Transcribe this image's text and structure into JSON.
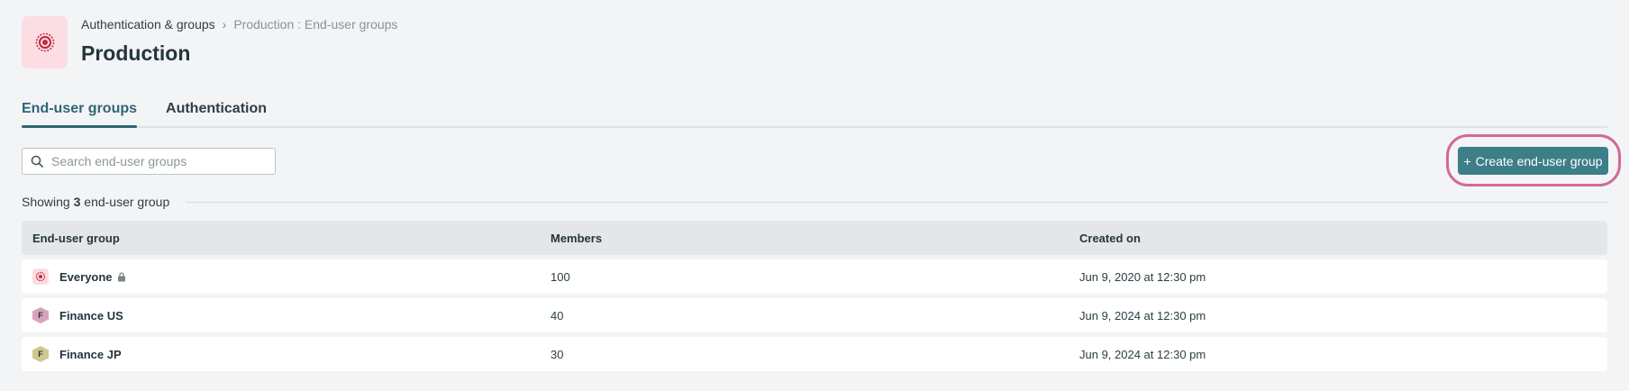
{
  "breadcrumb": {
    "parent": "Authentication & groups",
    "current": "Production : End-user groups"
  },
  "page": {
    "title": "Production"
  },
  "tabs": [
    {
      "label": "End-user groups",
      "active": true
    },
    {
      "label": "Authentication",
      "active": false
    }
  ],
  "search": {
    "placeholder": "Search end-user groups",
    "value": ""
  },
  "actions": {
    "create_label": "Create end-user group",
    "create_icon": "plus-icon"
  },
  "summary": {
    "prefix": "Showing",
    "count": "3",
    "suffix": "end-user group"
  },
  "table": {
    "columns": [
      "End-user group",
      "Members",
      "Created on"
    ],
    "rows": [
      {
        "name": "Everyone",
        "initial": "",
        "icon": "everyone-icon",
        "locked": true,
        "members": "100",
        "created": "Jun 9, 2020 at 12:30 pm"
      },
      {
        "name": "Finance US",
        "initial": "F",
        "icon": "hexagon-avatar",
        "avatar_color": "#d7a3bd",
        "locked": false,
        "members": "40",
        "created": "Jun 9, 2024 at 12:30 pm"
      },
      {
        "name": "Finance JP",
        "initial": "F",
        "icon": "hexagon-avatar",
        "avatar_color": "#cdc98f",
        "locked": false,
        "members": "30",
        "created": "Jun 9, 2024 at 12:30 pm"
      }
    ]
  },
  "colors": {
    "accent": "#3d7f88",
    "highlight": "#d36a93",
    "logo_bg": "#fbdde3",
    "logo_fg": "#c0283e"
  }
}
